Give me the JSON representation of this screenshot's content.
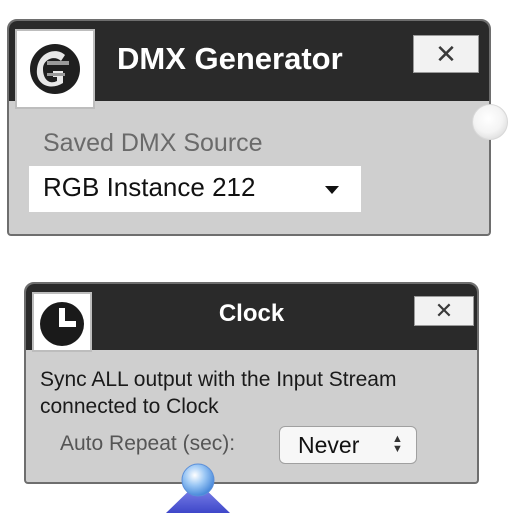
{
  "dmx_node": {
    "title": "DMX Generator",
    "icon": "dmx-generator-icon",
    "close_label": "✕",
    "source_label": "Saved DMX Source",
    "source_value": "RGB Instance 212",
    "dropdown_icon": "chevron-down-icon",
    "output_port_icon": "connector-port-icon"
  },
  "clock_node": {
    "title": "Clock",
    "icon": "clock-icon",
    "close_label": "✕",
    "description": "Sync ALL output with the Input Stream connected to Clock",
    "repeat_label": "Auto Repeat (sec):",
    "repeat_value": "Never",
    "stepper_icon": "stepper-icon",
    "input_port_icon": "connector-port-icon"
  },
  "colors": {
    "header": "#2a2a2a",
    "body": "#cfcfcf",
    "port_blue": "#4a90e2"
  }
}
